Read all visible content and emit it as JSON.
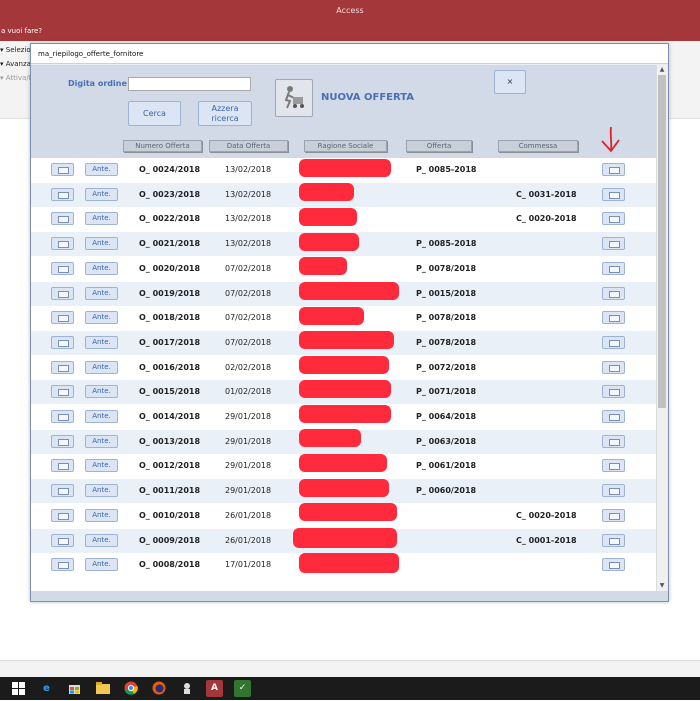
{
  "app": {
    "title": "Access",
    "tell_me": "a vuoi fare?"
  },
  "ribbon": {
    "items": [
      "Selezion",
      "Avanzat",
      "Attiva/D"
    ]
  },
  "window": {
    "title": "ma_riepilogo_offerte_fornitore",
    "order_label": "Digita ordine",
    "order_value": "",
    "search_button": "Cerca",
    "reset_button": "Azzera ricerca",
    "new_offer_label": "NUOVA OFFERTA",
    "close_button": "×"
  },
  "columns": [
    "Numero Offerta",
    "Data Offerta",
    "Ragione Sociale",
    "Offerta",
    "Commessa"
  ],
  "row_button_label": "Ante.",
  "rows": [
    {
      "num": "O_ 0024/2018",
      "date": "13/02/2018",
      "offer": "P_ 0085-2018",
      "commessa": ""
    },
    {
      "num": "O_ 0023/2018",
      "date": "13/02/2018",
      "offer": "",
      "commessa": "C_ 0031-2018"
    },
    {
      "num": "O_ 0022/2018",
      "date": "13/02/2018",
      "offer": "",
      "commessa": "C_ 0020-2018"
    },
    {
      "num": "O_ 0021/2018",
      "date": "13/02/2018",
      "offer": "P_ 0085-2018",
      "commessa": ""
    },
    {
      "num": "O_ 0020/2018",
      "date": "07/02/2018",
      "offer": "P_ 0078/2018",
      "commessa": ""
    },
    {
      "num": "O_ 0019/2018",
      "date": "07/02/2018",
      "offer": "P_ 0015/2018",
      "commessa": ""
    },
    {
      "num": "O_ 0018/2018",
      "date": "07/02/2018",
      "offer": "P_ 0078/2018",
      "commessa": ""
    },
    {
      "num": "O_ 0017/2018",
      "date": "07/02/2018",
      "offer": "P_ 0078/2018",
      "commessa": ""
    },
    {
      "num": "O_ 0016/2018",
      "date": "02/02/2018",
      "offer": "P_ 0072/2018",
      "commessa": ""
    },
    {
      "num": "O_ 0015/2018",
      "date": "01/02/2018",
      "offer": "P_ 0071/2018",
      "commessa": ""
    },
    {
      "num": "O_ 0014/2018",
      "date": "29/01/2018",
      "offer": "P_ 0064/2018",
      "commessa": ""
    },
    {
      "num": "O_ 0013/2018",
      "date": "29/01/2018",
      "offer": "P_ 0063/2018",
      "commessa": ""
    },
    {
      "num": "O_ 0012/2018",
      "date": "29/01/2018",
      "offer": "P_ 0061/2018",
      "commessa": ""
    },
    {
      "num": "O_ 0011/2018",
      "date": "29/01/2018",
      "offer": "P_ 0060/2018",
      "commessa": ""
    },
    {
      "num": "O_ 0010/2018",
      "date": "26/01/2018",
      "offer": "",
      "commessa": "C_ 0020-2018"
    },
    {
      "num": "O_ 0009/2018",
      "date": "26/01/2018",
      "offer": "",
      "commessa": "C_ 0001-2018"
    },
    {
      "num": "O_ 0008/2018",
      "date": "17/01/2018",
      "offer": "",
      "commessa": ""
    }
  ],
  "colors": {
    "access_red": "#a4373a",
    "accent_blue": "#4a6fb5",
    "redaction": "#ff2a3b",
    "annotation_arrow": "#e0202a"
  },
  "icons": {
    "row_open": "form-icon",
    "new_offer": "delivery-person-icon",
    "annotation": "hand-drawn-arrow-icon"
  },
  "taskbar": {
    "icons": [
      "windows-start-icon",
      "edge-icon",
      "store-icon",
      "file-explorer-icon",
      "chrome-icon",
      "firefox-icon",
      "app-icon",
      "access-icon",
      "project-icon"
    ]
  }
}
